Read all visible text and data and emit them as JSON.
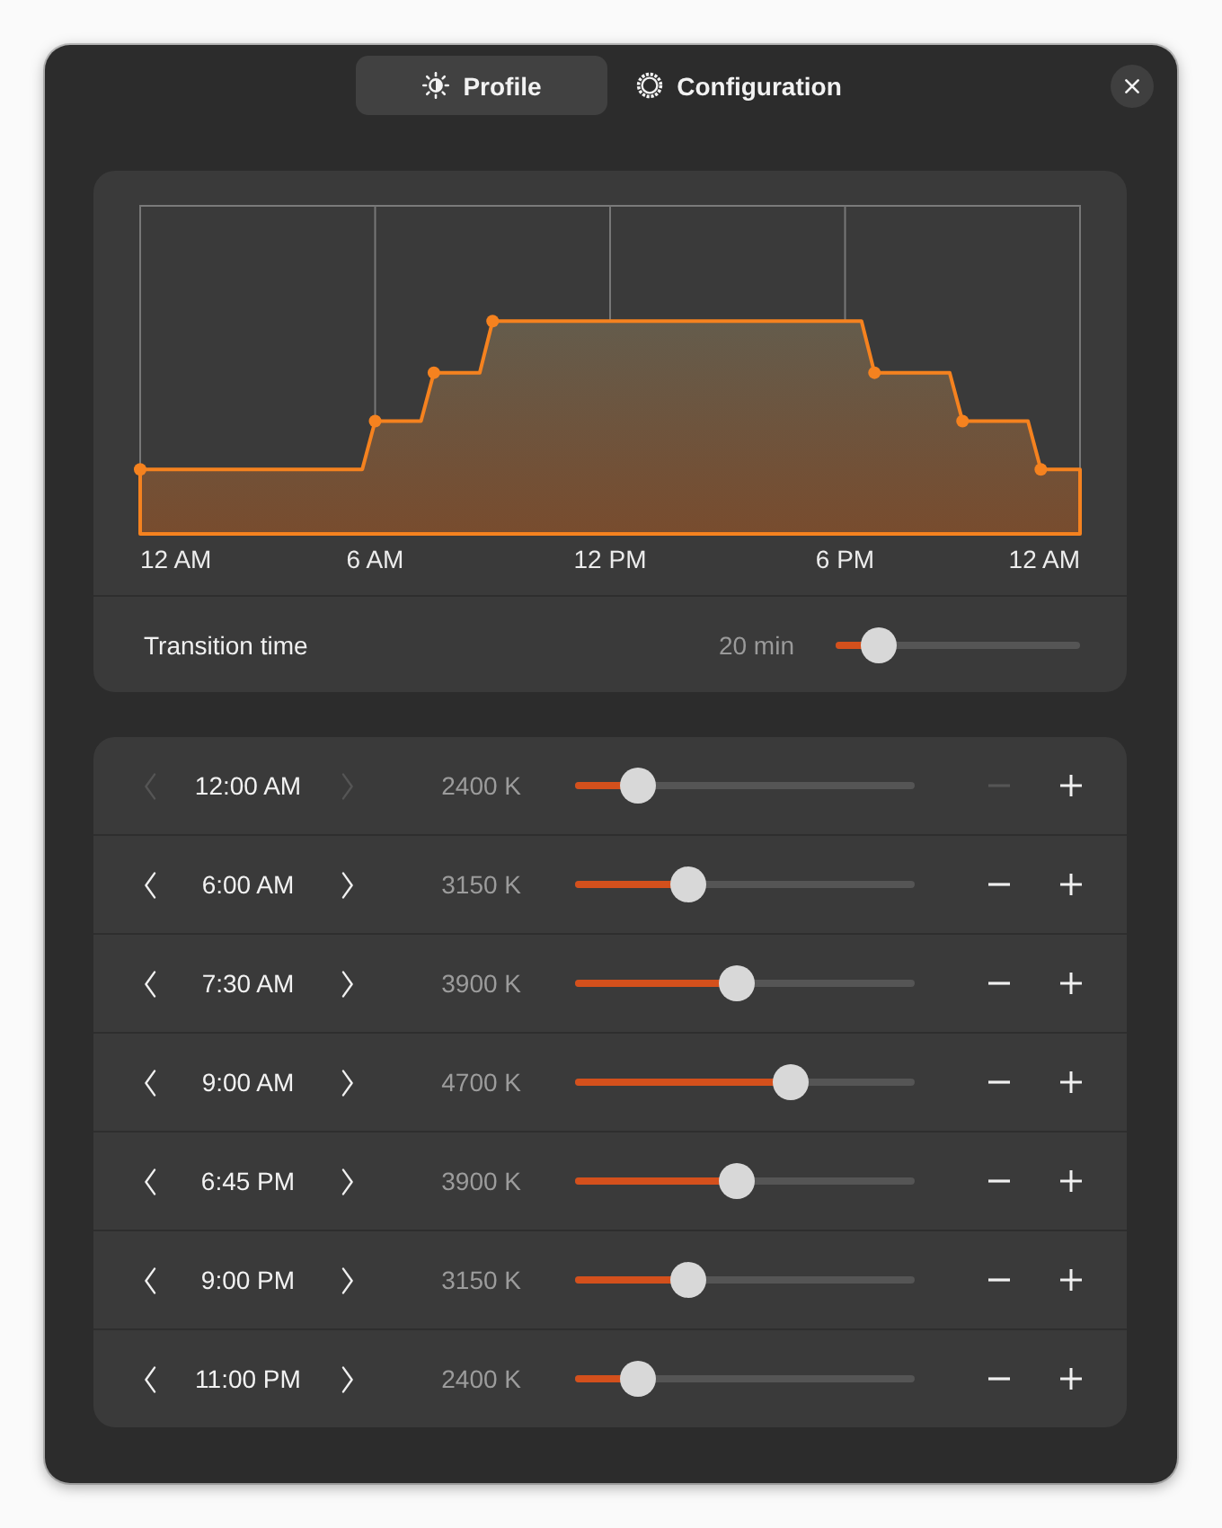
{
  "tabs": [
    {
      "label": "Profile",
      "selected": true
    },
    {
      "label": "Configuration",
      "selected": false
    }
  ],
  "chart": {
    "x_axis_labels": [
      "12 AM",
      "6 AM",
      "12 PM",
      "6 PM",
      "12 AM"
    ]
  },
  "transition": {
    "label": "Transition time",
    "reading": "20 min",
    "level": 0.18
  },
  "setpoints": [
    {
      "time": "12:00 AM",
      "temperature": "2400 K",
      "level": 0.185,
      "earlier_disabled": true,
      "later_disabled": true,
      "remove_disabled": true
    },
    {
      "time": "6:00 AM",
      "temperature": "3150 K",
      "level": 0.335,
      "earlier_disabled": false,
      "later_disabled": false,
      "remove_disabled": false
    },
    {
      "time": "7:30 AM",
      "temperature": "3900 K",
      "level": 0.475,
      "earlier_disabled": false,
      "later_disabled": false,
      "remove_disabled": false
    },
    {
      "time": "9:00 AM",
      "temperature": "4700 K",
      "level": 0.635,
      "earlier_disabled": false,
      "later_disabled": false,
      "remove_disabled": false
    },
    {
      "time": "6:45 PM",
      "temperature": "3900 K",
      "level": 0.475,
      "earlier_disabled": false,
      "later_disabled": false,
      "remove_disabled": false
    },
    {
      "time": "9:00 PM",
      "temperature": "3150 K",
      "level": 0.335,
      "earlier_disabled": false,
      "later_disabled": false,
      "remove_disabled": false
    },
    {
      "time": "11:00 PM",
      "temperature": "2400 K",
      "level": 0.185,
      "earlier_disabled": false,
      "later_disabled": false,
      "remove_disabled": false
    }
  ]
}
